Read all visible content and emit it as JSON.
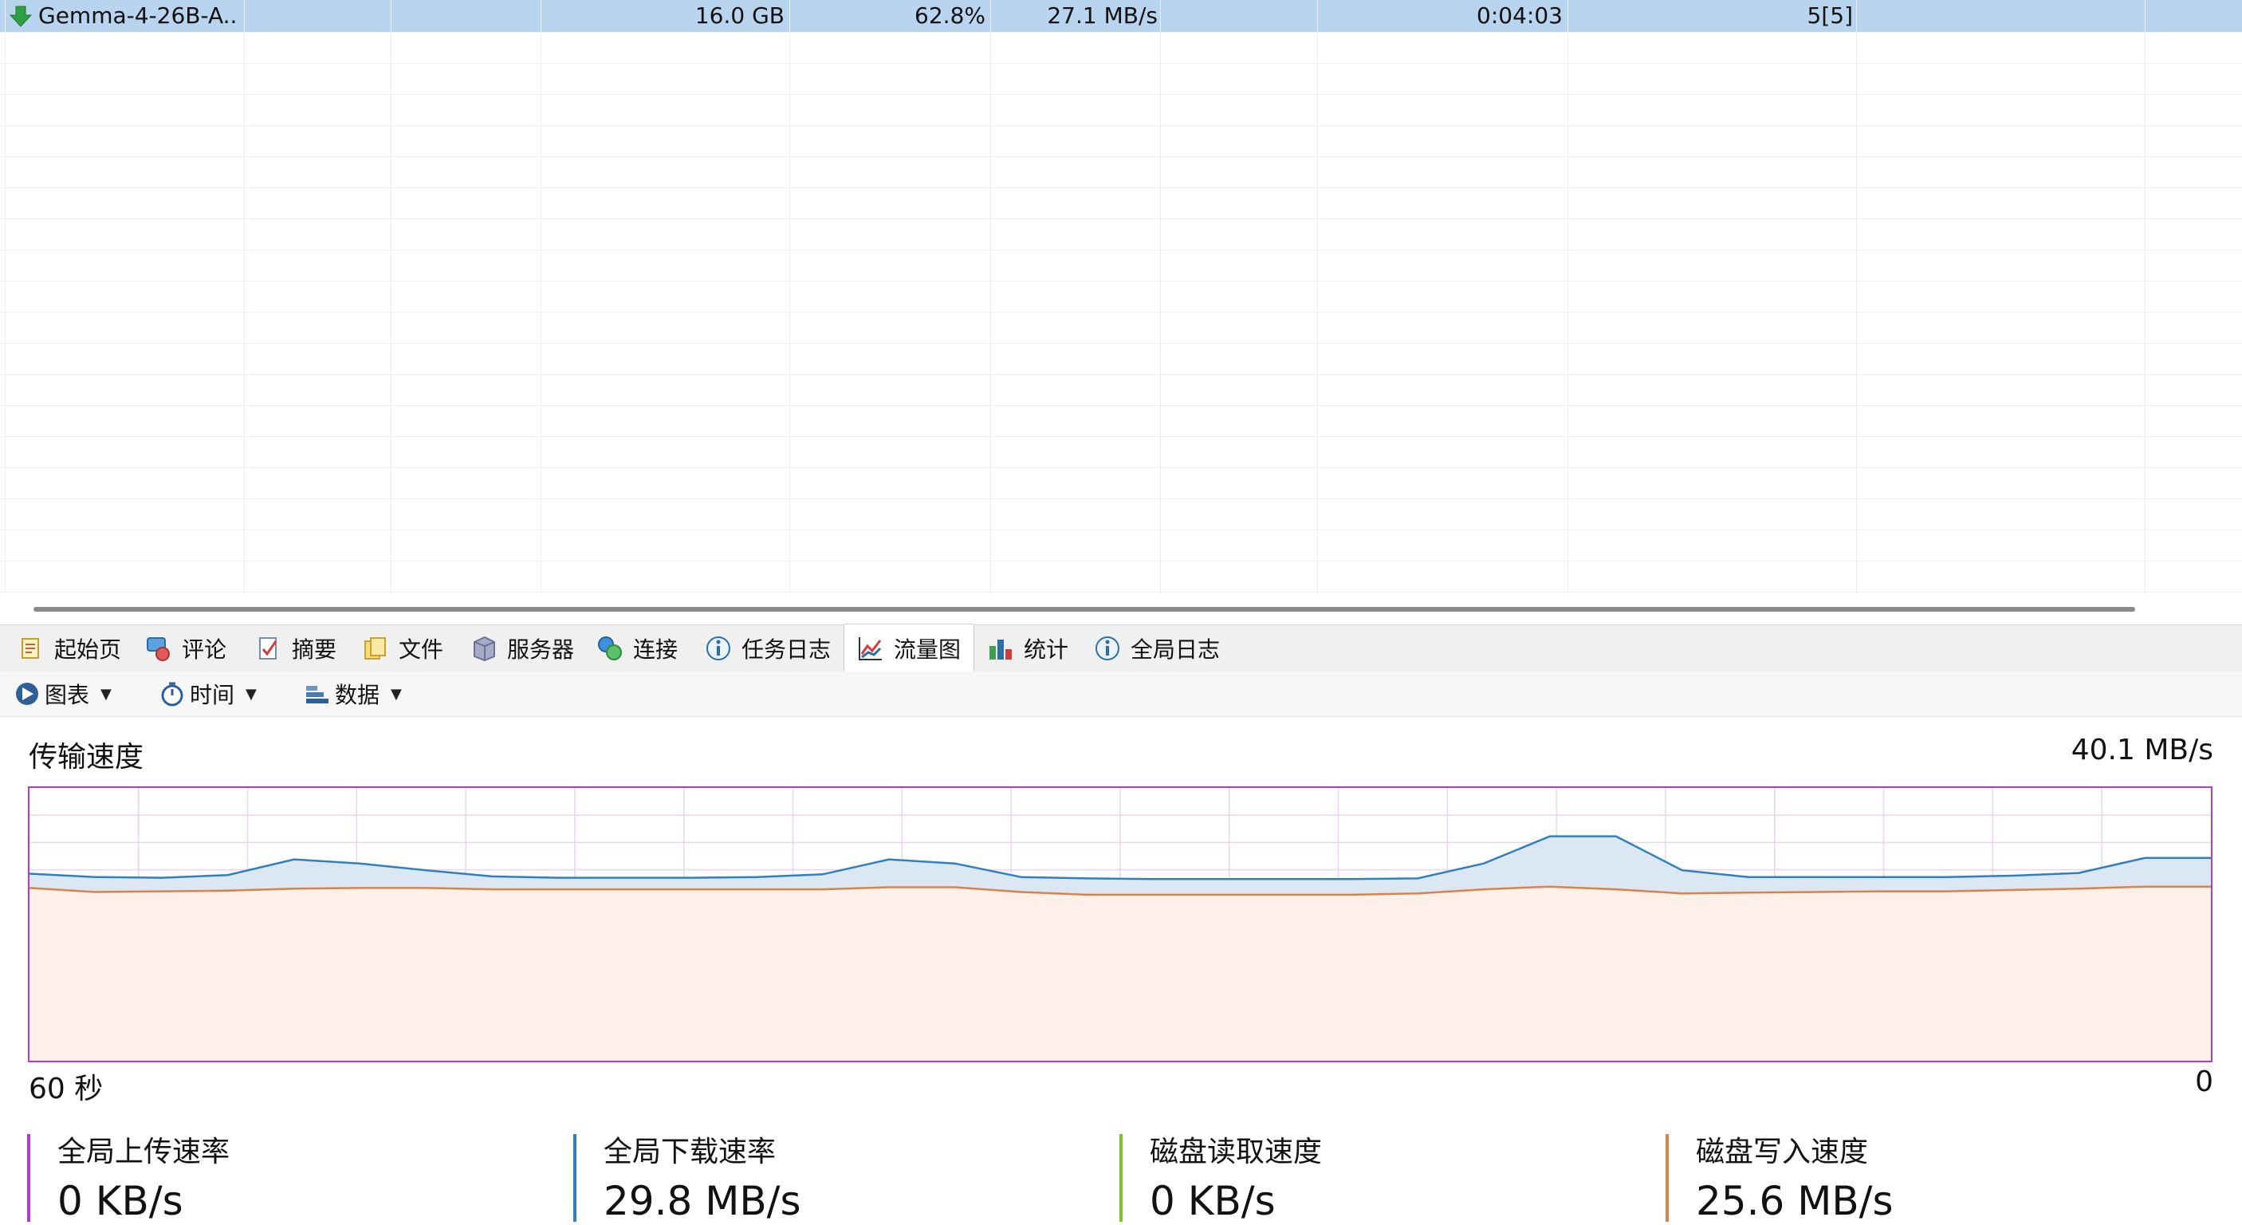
{
  "table": {
    "row": {
      "name": "Gemma-4-26B-A...",
      "size": "16.0 GB",
      "progress": "62.8%",
      "speed": "27.1 MB/s",
      "remaining": "0:04:03",
      "connections": "5[5]"
    }
  },
  "tabs": [
    {
      "label": "起始页",
      "icon": "home-page-icon"
    },
    {
      "label": "评论",
      "icon": "comment-icon"
    },
    {
      "label": "摘要",
      "icon": "summary-icon"
    },
    {
      "label": "文件",
      "icon": "file-icon"
    },
    {
      "label": "服务器",
      "icon": "server-icon"
    },
    {
      "label": "连接",
      "icon": "connection-icon"
    },
    {
      "label": "任务日志",
      "icon": "info-icon"
    },
    {
      "label": "流量图",
      "icon": "line-chart-icon"
    },
    {
      "label": "统计",
      "icon": "statistics-icon"
    },
    {
      "label": "全局日志",
      "icon": "info-icon"
    }
  ],
  "active_tab": "流量图",
  "toolbar": {
    "chart_label": "图表",
    "time_label": "时间",
    "data_label": "数据"
  },
  "panel": {
    "title": "传输速度",
    "max_value": "40.1 MB/s",
    "axis_left": "60 秒",
    "axis_right": "0"
  },
  "stats": [
    {
      "label": "全局上传速率",
      "value": "0 KB/s",
      "color": "#b03cc8"
    },
    {
      "label": "全局下载速率",
      "value": "29.8 MB/s",
      "color": "#2f7fc1"
    },
    {
      "label": "磁盘读取速度",
      "value": "0 KB/s",
      "color": "#7dc22f"
    },
    {
      "label": "磁盘写入速度",
      "value": "25.6 MB/s",
      "color": "#d9824a"
    }
  ],
  "chart_data": {
    "type": "area",
    "title": "传输速度",
    "x_range_label_left": "60 秒",
    "x_range_label_right": "0",
    "ylim": [
      0,
      40.1
    ],
    "grid": true,
    "series": [
      {
        "color": "#2f7fc1",
        "fill": "#dbe8f3",
        "values": [
          27.5,
          27.0,
          26.9,
          27.3,
          29.6,
          29.0,
          28.0,
          27.1,
          26.9,
          26.9,
          26.9,
          27.0,
          27.4,
          29.6,
          29.0,
          27.0,
          26.8,
          26.7,
          26.7,
          26.7,
          26.7,
          26.8,
          29.0,
          33.0,
          33.0,
          28.0,
          27.0,
          27.0,
          27.0,
          27.0,
          27.2,
          27.6,
          29.8,
          29.8
        ]
      },
      {
        "color": "#d9824a",
        "fill": "#fcf0e8",
        "values": [
          25.4,
          24.8,
          24.9,
          25.0,
          25.3,
          25.4,
          25.4,
          25.2,
          25.2,
          25.2,
          25.2,
          25.2,
          25.2,
          25.5,
          25.5,
          24.8,
          24.4,
          24.4,
          24.4,
          24.4,
          24.4,
          24.6,
          25.2,
          25.6,
          25.2,
          24.6,
          24.7,
          24.8,
          24.9,
          24.9,
          25.1,
          25.3,
          25.6,
          25.6
        ]
      }
    ]
  }
}
